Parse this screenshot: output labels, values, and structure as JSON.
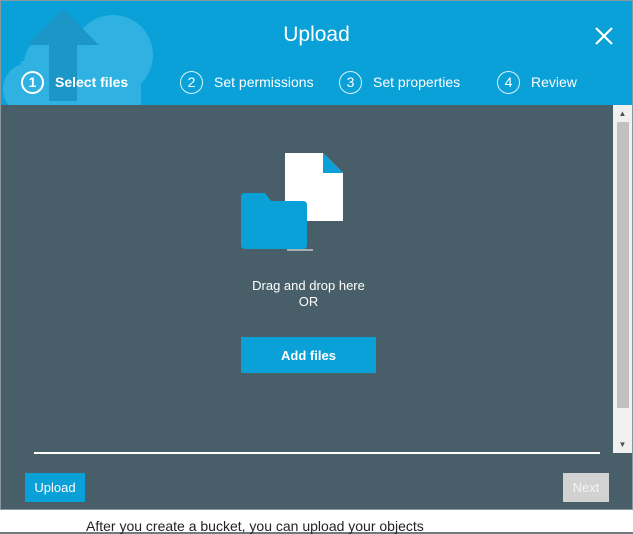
{
  "background": {
    "text": "After you create a bucket, you can upload your objects"
  },
  "dialog": {
    "title": "Upload",
    "close_icon": "close-icon",
    "steps": [
      {
        "number": "1",
        "label": "Select files",
        "active": true
      },
      {
        "number": "2",
        "label": "Set permissions",
        "active": false
      },
      {
        "number": "3",
        "label": "Set properties",
        "active": false
      },
      {
        "number": "4",
        "label": "Review",
        "active": false
      }
    ],
    "dropzone": {
      "line1": "Drag and drop here",
      "line2": "OR",
      "add_files_label": "Add files",
      "icons": [
        "file-icon",
        "folder-icon"
      ]
    },
    "footer": {
      "upload_label": "Upload",
      "next_label": "Next"
    }
  },
  "colors": {
    "accent": "#0aa0d8",
    "dialog_body": "#485f69",
    "disabled_button": "#d2d2d2"
  }
}
